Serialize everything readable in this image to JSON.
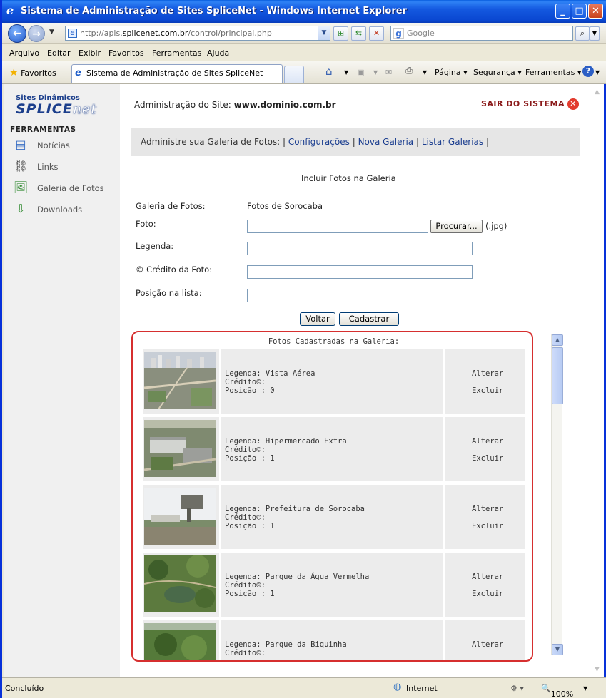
{
  "window": {
    "title": "Sistema de Administração de Sites SpliceNet - Windows Internet Explorer",
    "address_prefix": "http://apis.",
    "address_domain": "splicenet.com.br",
    "address_path": "/control/principal.php",
    "search_placeholder": "Google"
  },
  "menu": [
    "Arquivo",
    "Editar",
    "Exibir",
    "Favoritos",
    "Ferramentas",
    "Ajuda"
  ],
  "tabbar": {
    "favorites_label": "Favoritos",
    "tab_title": "Sistema de Administração de Sites SpliceNet",
    "page_label": "Página",
    "security_label": "Segurança",
    "tools_label": "Ferramentas"
  },
  "sidebar": {
    "logo_line1": "Sites Dinâmicos",
    "logo_line2": "SPLICE",
    "logo_line3": "net",
    "section_title": "FERRAMENTAS",
    "items": [
      {
        "label": "Notícias",
        "icon": "news-icon"
      },
      {
        "label": "Links",
        "icon": "chain-link-icon"
      },
      {
        "label": "Galeria de Fotos",
        "icon": "photo-gallery-icon"
      },
      {
        "label": "Downloads",
        "icon": "download-icon"
      }
    ]
  },
  "header": {
    "admin_prefix": "Administração do Site:",
    "site": "www.dominio.com.br",
    "logout": "SAIR DO SISTEMA"
  },
  "nav": {
    "prefix": "Administre sua Galeria de Fotos: |",
    "config": "Configurações",
    "new_gallery": "Nova Galeria",
    "list_galleries": "Listar Galerias",
    "sep": "|"
  },
  "form": {
    "title": "Incluir Fotos na Galeria",
    "gallery_label": "Galeria de Fotos:",
    "gallery_value": "Fotos de Sorocaba",
    "photo_label": "Foto:",
    "browse_button": "Procurar...",
    "photo_hint": "(.jpg)",
    "caption_label": "Legenda:",
    "credit_label": "© Crédito da Foto:",
    "position_label": "Posição na lista:",
    "back_button": "Voltar",
    "submit_button": "Cadastrar"
  },
  "gallery": {
    "title": "Fotos Cadastradas na Galeria:",
    "edit_label": "Alterar",
    "delete_label": "Excluir",
    "photos": [
      {
        "caption": "Legenda: Vista Aérea",
        "credit": "Crédito©:",
        "position": "Posição : 0"
      },
      {
        "caption": "Legenda: Hipermercado Extra",
        "credit": "Crédito©:",
        "position": "Posição : 1"
      },
      {
        "caption": "Legenda: Prefeitura de Sorocaba",
        "credit": "Crédito©:",
        "position": "Posição : 1"
      },
      {
        "caption": "Legenda: Parque da Água Vermelha",
        "credit": "Crédito©:",
        "position": "Posição : 1"
      },
      {
        "caption": "Legenda: Parque da Biquinha",
        "credit": "Crédito©:",
        "position": ""
      }
    ]
  },
  "status": {
    "left": "Concluído",
    "zone": "Internet",
    "zoom": "100%"
  }
}
